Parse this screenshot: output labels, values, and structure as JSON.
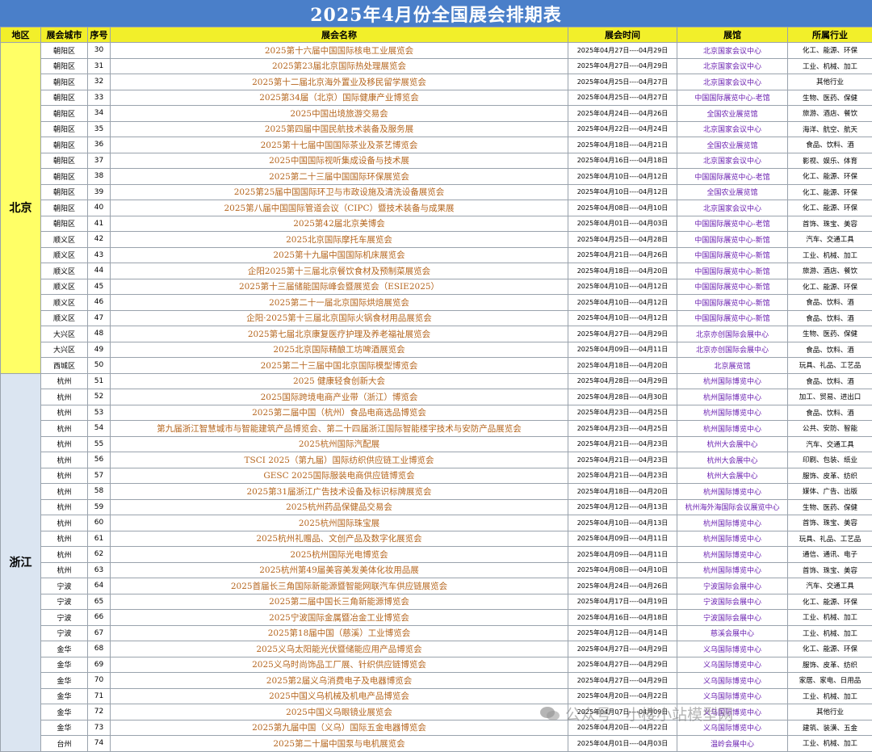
{
  "title": "2025年4月份全国展会排期表",
  "headers": [
    "地区",
    "展会城市",
    "序号",
    "展会名称",
    "展会时间",
    "展馆",
    "所属行业"
  ],
  "regions": [
    {
      "name": "北京",
      "rows": [
        [
          "朝阳区",
          "30",
          "2025第十六届中国国际核电工业展览会",
          "2025年04月27日----04月29日",
          "北京国家会议中心",
          "化工、能源、环保"
        ],
        [
          "朝阳区",
          "31",
          "2025第23届北京国际热处理展览会",
          "2025年04月27日----04月29日",
          "北京国家会议中心",
          "工业、机械、加工"
        ],
        [
          "朝阳区",
          "32",
          "2025第十二届北京海外置业及移民留学展览会",
          "2025年04月25日----04月27日",
          "北京国家会议中心",
          "其他行业"
        ],
        [
          "朝阳区",
          "33",
          "2025第34届（北京）国际健康产业博览会",
          "2025年04月25日----04月27日",
          "中国国际展览中心-老馆",
          "生物、医药、保健"
        ],
        [
          "朝阳区",
          "34",
          "2025中国出境旅游交易会",
          "2025年04月24日----04月26日",
          "全国农业展览馆",
          "旅游、酒店、餐饮"
        ],
        [
          "朝阳区",
          "35",
          "2025第四届中国民航技术装备及服务展",
          "2025年04月22日----04月24日",
          "北京国家会议中心",
          "海洋、航空、航天"
        ],
        [
          "朝阳区",
          "36",
          "2025第十七届中国国际茶业及茶艺博览会",
          "2025年04月18日----04月21日",
          "全国农业展览馆",
          "食品、饮料、酒"
        ],
        [
          "朝阳区",
          "37",
          "2025中国国际视听集成设备与技术展",
          "2025年04月16日----04月18日",
          "北京国家会议中心",
          "影视、娱乐、体育"
        ],
        [
          "朝阳区",
          "38",
          "2025第二十三届中国国际环保展览会",
          "2025年04月10日----04月12日",
          "中国国际展览中心-老馆",
          "化工、能源、环保"
        ],
        [
          "朝阳区",
          "39",
          "2025第25届中国国际环卫与市政设施及清洗设备展览会",
          "2025年04月10日----04月12日",
          "全国农业展览馆",
          "化工、能源、环保"
        ],
        [
          "朝阳区",
          "40",
          "2025第八届中国国际管道会议（CIPC）暨技术装备与成果展",
          "2025年04月08日----04月10日",
          "北京国家会议中心",
          "化工、能源、环保"
        ],
        [
          "朝阳区",
          "41",
          "2025第42届北京美博会",
          "2025年04月01日----04月03日",
          "中国国际展览中心-老馆",
          "首饰、珠宝、美容"
        ],
        [
          "顺义区",
          "42",
          "2025北京国际摩托车展览会",
          "2025年04月25日----04月28日",
          "中国国际展览中心-新馆",
          "汽车、交通工具"
        ],
        [
          "顺义区",
          "43",
          "2025第十九届中国国际机床展览会",
          "2025年04月21日----04月26日",
          "中国国际展览中心-新馆",
          "工业、机械、加工"
        ],
        [
          "顺义区",
          "44",
          "企阳2025第十三届北京餐饮食材及预制菜展览会",
          "2025年04月18日----04月20日",
          "中国国际展览中心-新馆",
          "旅游、酒店、餐饮"
        ],
        [
          "顺义区",
          "45",
          "2025第十三届储能国际峰会暨展览会（ESIE2025）",
          "2025年04月10日----04月12日",
          "中国国际展览中心-新馆",
          "化工、能源、环保"
        ],
        [
          "顺义区",
          "46",
          "2025第二十一届北京国际烘焙展览会",
          "2025年04月10日----04月12日",
          "中国国际展览中心-新馆",
          "食品、饮料、酒"
        ],
        [
          "顺义区",
          "47",
          "企阳·2025第十三届北京国际火锅食材用品展览会",
          "2025年04月10日----04月12日",
          "中国国际展览中心-新馆",
          "食品、饮料、酒"
        ],
        [
          "大兴区",
          "48",
          "2025第七届北京康复医疗护理及养老福祉展览会",
          "2025年04月27日----04月29日",
          "北京亦创国际会展中心",
          "生物、医药、保健"
        ],
        [
          "大兴区",
          "49",
          "2025北京国际精酿工坊啤酒展览会",
          "2025年04月09日----04月11日",
          "北京亦创国际会展中心",
          "食品、饮料、酒"
        ],
        [
          "西城区",
          "50",
          "2025第二十三届中国北京国际模型博览会",
          "2025年04月18日----04月20日",
          "北京展览馆",
          "玩具、礼品、工艺品"
        ]
      ]
    },
    {
      "name": "浙江",
      "rows": [
        [
          "杭州",
          "51",
          "2025 健康轻食创新大会",
          "2025年04月28日----04月29日",
          "杭州国际博览中心",
          "食品、饮料、酒"
        ],
        [
          "杭州",
          "52",
          "2025国际跨境电商产业带（浙江）博览会",
          "2025年04月28日----04月30日",
          "杭州国际博览中心",
          "加工、贸易、进出口"
        ],
        [
          "杭州",
          "53",
          "2025第二届中国（杭州）食品电商选品博览会",
          "2025年04月23日----04月25日",
          "杭州国际博览中心",
          "食品、饮料、酒"
        ],
        [
          "杭州",
          "54",
          "第九届浙江智慧城市与智能建筑产品博览会、第二十四届浙江国际智能楼宇技术与安防产品展览会",
          "2025年04月23日----04月25日",
          "杭州国际博览中心",
          "公共、安防、智能"
        ],
        [
          "杭州",
          "55",
          "2025杭州国际汽配展",
          "2025年04月21日----04月23日",
          "杭州大会展中心",
          "汽车、交通工具"
        ],
        [
          "杭州",
          "56",
          "TSCI 2025（第九届）国际纺织供应链工业博览会",
          "2025年04月21日----04月23日",
          "杭州大会展中心",
          "印刷、包装、纸业"
        ],
        [
          "杭州",
          "57",
          "GESC 2025国际服装电商供应链博览会",
          "2025年04月21日----04月23日",
          "杭州大会展中心",
          "服饰、皮革、纺织"
        ],
        [
          "杭州",
          "58",
          "2025第31届浙江广告技术设备及标识标牌展览会",
          "2025年04月18日----04月20日",
          "杭州国际博览中心",
          "媒体、广告、出版"
        ],
        [
          "杭州",
          "59",
          "2025杭州药品保健品交易会",
          "2025年04月12日----04月13日",
          "杭州海外海国际会议展览中心",
          "生物、医药、保健"
        ],
        [
          "杭州",
          "60",
          "2025杭州国际珠宝展",
          "2025年04月10日----04月13日",
          "杭州国际博览中心",
          "首饰、珠宝、美容"
        ],
        [
          "杭州",
          "61",
          "2025杭州礼赠品、文创产品及数字化展览会",
          "2025年04月09日----04月11日",
          "杭州国际博览中心",
          "玩具、礼品、工艺品"
        ],
        [
          "杭州",
          "62",
          "2025杭州国际光电博览会",
          "2025年04月09日----04月11日",
          "杭州国际博览中心",
          "通信、通讯、电子"
        ],
        [
          "杭州",
          "63",
          "2025杭州第49届美容美发美体化妆用品展",
          "2025年04月08日----04月10日",
          "杭州国际博览中心",
          "首饰、珠宝、美容"
        ],
        [
          "宁波",
          "64",
          "2025首届长三角国际新能源暨智能网联汽车供应链展览会",
          "2025年04月24日----04月26日",
          "宁波国际会展中心",
          "汽车、交通工具"
        ],
        [
          "宁波",
          "65",
          "2025第二届中国长三角新能源博览会",
          "2025年04月17日----04月19日",
          "宁波国际会展中心",
          "化工、能源、环保"
        ],
        [
          "宁波",
          "66",
          "2025宁波国际金属暨冶金工业博览会",
          "2025年04月16日----04月18日",
          "宁波国际会展中心",
          "工业、机械、加工"
        ],
        [
          "宁波",
          "67",
          "2025第18届中国（慈溪）工业博览会",
          "2025年04月12日----04月14日",
          "慈溪会展中心",
          "工业、机械、加工"
        ],
        [
          "金华",
          "68",
          "2025义乌太阳能光伏暨储能应用产品博览会",
          "2025年04月27日----04月29日",
          "义乌国际博览中心",
          "化工、能源、环保"
        ],
        [
          "金华",
          "69",
          "2025义乌时尚饰品工厂展、针织供应链博览会",
          "2025年04月27日----04月29日",
          "义乌国际博览中心",
          "服饰、皮革、纺织"
        ],
        [
          "金华",
          "70",
          "2025第2届义乌消费电子及电器博览会",
          "2025年04月27日----04月29日",
          "义乌国际博览中心",
          "家居、家电、日用品"
        ],
        [
          "金华",
          "71",
          "2025中国义乌机械及机电产品博览会",
          "2025年04月20日----04月22日",
          "义乌国际博览中心",
          "工业、机械、加工"
        ],
        [
          "金华",
          "72",
          "2025中国义乌眼镜业展览会",
          "2025年04月07日----04月09日",
          "义乌国际博览中心",
          "其他行业"
        ],
        [
          "金华",
          "73",
          "2025第九届中国（义乌）国际五金电器博览会",
          "2025年04月20日----04月22日",
          "义乌国际博览中心",
          "建筑、装潢、五金"
        ],
        [
          "台州",
          "74",
          "2025第二十届中国泵与电机展览会",
          "2025年04月01日----04月03日",
          "温岭会展中心",
          "工业、机械、加工"
        ]
      ]
    }
  ],
  "watermark": "公众号 · 小楼小站模型网",
  "colors": {
    "title_bg": "#4a7fc9",
    "header_bg": "#f2ef2a",
    "beijing_bg": "#ffff66",
    "zhejiang_bg": "#dbe5f1",
    "name_color": "#b5651d",
    "venue_color": "#6a1fb0"
  },
  "icons": {
    "watermark": "wechat-icon"
  }
}
